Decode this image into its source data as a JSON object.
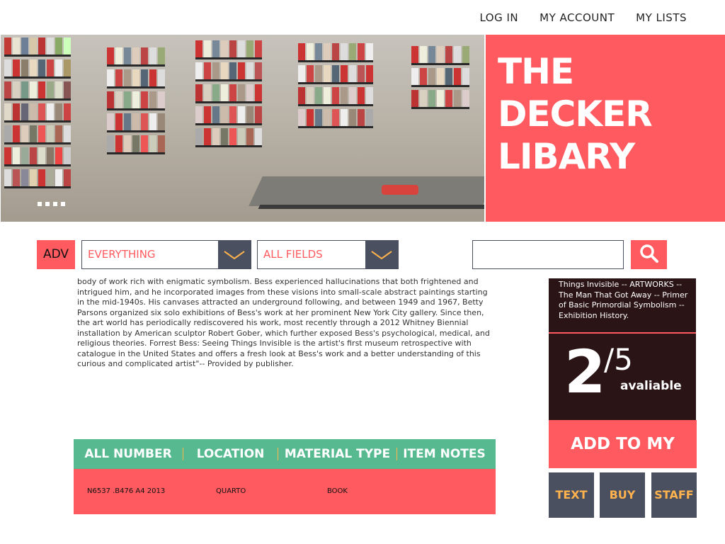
{
  "nav": {
    "login": "LOG IN",
    "account": "MY ACCOUNT",
    "lists": "MY LISTS"
  },
  "hero": {
    "title_lines": [
      "THE",
      "DECKER",
      "LIBARY"
    ]
  },
  "search": {
    "adv": "ADV",
    "scope": "EVERYTHING",
    "field": "ALL FIELDS",
    "query": "",
    "placeholder": ""
  },
  "description": "body of work rich with enigmatic symbolism. Bess experienced hallucinations that both frightened and intrigued him, and he incorporated images from these visions into small-scale abstract paintings starting in the mid-1940s. His canvases attracted an underground following, and between 1949 and 1967, Betty Parsons organized six solo exhibitions of Bess's work at her prominent New York City gallery. Since then, the art world has periodically rediscovered his work, most recently through a 2012 Whitney Biennial installation by American sculptor Robert Gober, which further exposed Bess's psychological, medical, and religious theories. Forrest Bess: Seeing Things Invisible is the artist's first museum retrospective with catalogue in the United States and offers a fresh look at Bess's work and a better understanding of this curious and complicated artist\"-- Provided by publisher.",
  "sidebar": {
    "contents": "Things Invisible -- ARTWORKS -- The Man That Got Away -- Primer of Basic Primordial Symbolism -- Exhibition History.",
    "available_count": "2",
    "total": "/5",
    "available_word": "avaliable",
    "add_list": "ADD TO MY LIST",
    "btn_text": "TEXT",
    "btn_buy": "BUY",
    "btn_staff": "STAFF"
  },
  "holdings": {
    "headers": [
      "ALL NUMBER",
      "LOCATION",
      "MATERIAL TYPE",
      "ITEM NOTES"
    ],
    "rows": [
      {
        "call_number": "N6537 .B476 A4 2013",
        "location": "QUARTO",
        "material": "BOOK",
        "notes": ""
      }
    ]
  },
  "colors": {
    "accent": "#ff5a5f",
    "dark": "#2b1416",
    "slate": "#4a5060",
    "green": "#57b98f",
    "orange": "#ffb24d"
  }
}
